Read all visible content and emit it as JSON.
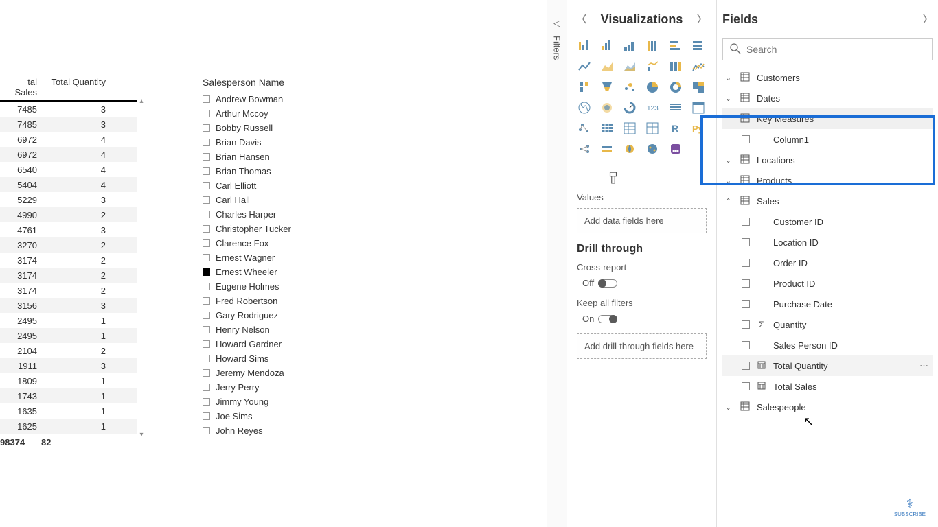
{
  "canvas": {
    "table": {
      "columns": [
        "tal Sales",
        "Total Quantity"
      ],
      "rows": [
        {
          "sales": 7485,
          "qty": 3
        },
        {
          "sales": 7485,
          "qty": 3
        },
        {
          "sales": 6972,
          "qty": 4
        },
        {
          "sales": 6972,
          "qty": 4
        },
        {
          "sales": 6540,
          "qty": 4
        },
        {
          "sales": 5404,
          "qty": 4
        },
        {
          "sales": 5229,
          "qty": 3
        },
        {
          "sales": 4990,
          "qty": 2
        },
        {
          "sales": 4761,
          "qty": 3
        },
        {
          "sales": 3270,
          "qty": 2
        },
        {
          "sales": 3174,
          "qty": 2
        },
        {
          "sales": 3174,
          "qty": 2
        },
        {
          "sales": 3174,
          "qty": 2
        },
        {
          "sales": 3156,
          "qty": 3
        },
        {
          "sales": 2495,
          "qty": 1
        },
        {
          "sales": 2495,
          "qty": 1
        },
        {
          "sales": 2104,
          "qty": 2
        },
        {
          "sales": 1911,
          "qty": 3
        },
        {
          "sales": 1809,
          "qty": 1
        },
        {
          "sales": 1743,
          "qty": 1
        },
        {
          "sales": 1635,
          "qty": 1
        },
        {
          "sales": 1625,
          "qty": 1
        }
      ],
      "total": {
        "sales": 98374,
        "qty": 82
      }
    },
    "slicer": {
      "title": "Salesperson Name",
      "items": [
        {
          "label": "Andrew Bowman",
          "checked": false
        },
        {
          "label": "Arthur Mccoy",
          "checked": false
        },
        {
          "label": "Bobby Russell",
          "checked": false
        },
        {
          "label": "Brian Davis",
          "checked": false
        },
        {
          "label": "Brian Hansen",
          "checked": false
        },
        {
          "label": "Brian Thomas",
          "checked": false
        },
        {
          "label": "Carl Elliott",
          "checked": false
        },
        {
          "label": "Carl Hall",
          "checked": false
        },
        {
          "label": "Charles Harper",
          "checked": false
        },
        {
          "label": "Christopher Tucker",
          "checked": false
        },
        {
          "label": "Clarence Fox",
          "checked": false
        },
        {
          "label": "Ernest Wagner",
          "checked": false
        },
        {
          "label": "Ernest Wheeler",
          "checked": true
        },
        {
          "label": "Eugene Holmes",
          "checked": false
        },
        {
          "label": "Fred Robertson",
          "checked": false
        },
        {
          "label": "Gary Rodriguez",
          "checked": false
        },
        {
          "label": "Henry Nelson",
          "checked": false
        },
        {
          "label": "Howard Gardner",
          "checked": false
        },
        {
          "label": "Howard Sims",
          "checked": false
        },
        {
          "label": "Jeremy Mendoza",
          "checked": false
        },
        {
          "label": "Jerry Perry",
          "checked": false
        },
        {
          "label": "Jimmy Young",
          "checked": false
        },
        {
          "label": "Joe Sims",
          "checked": false
        },
        {
          "label": "John Reyes",
          "checked": false
        }
      ]
    }
  },
  "filters": {
    "label": "Filters"
  },
  "visualizations": {
    "title": "Visualizations",
    "values_label": "Values",
    "values_placeholder": "Add data fields here",
    "drill_title": "Drill through",
    "cross_report_label": "Cross-report",
    "cross_report_state": "Off",
    "keep_filters_label": "Keep all filters",
    "keep_filters_state": "On",
    "drill_placeholder": "Add drill-through fields here"
  },
  "fields": {
    "title": "Fields",
    "search_placeholder": "Search",
    "tables": [
      {
        "name": "Customers",
        "expanded": false
      },
      {
        "name": "Dates",
        "expanded": false
      },
      {
        "name": "Key Measures",
        "expanded": true,
        "highlighted": true,
        "fields": [
          {
            "name": "Column1",
            "type": ""
          }
        ]
      },
      {
        "name": "Locations",
        "expanded": false
      },
      {
        "name": "Products",
        "expanded": false
      },
      {
        "name": "Sales",
        "expanded": true,
        "fields": [
          {
            "name": "Customer ID",
            "type": ""
          },
          {
            "name": "Location ID",
            "type": ""
          },
          {
            "name": "Order ID",
            "type": ""
          },
          {
            "name": "Product ID",
            "type": ""
          },
          {
            "name": "Purchase Date",
            "type": ""
          },
          {
            "name": "Quantity",
            "type": "Σ"
          },
          {
            "name": "Sales Person ID",
            "type": ""
          },
          {
            "name": "Total Quantity",
            "type": "calc",
            "hover": true
          },
          {
            "name": "Total Sales",
            "type": "calc"
          }
        ]
      },
      {
        "name": "Salespeople",
        "expanded": false
      }
    ]
  },
  "subscribe": "SUBSCRIBE"
}
